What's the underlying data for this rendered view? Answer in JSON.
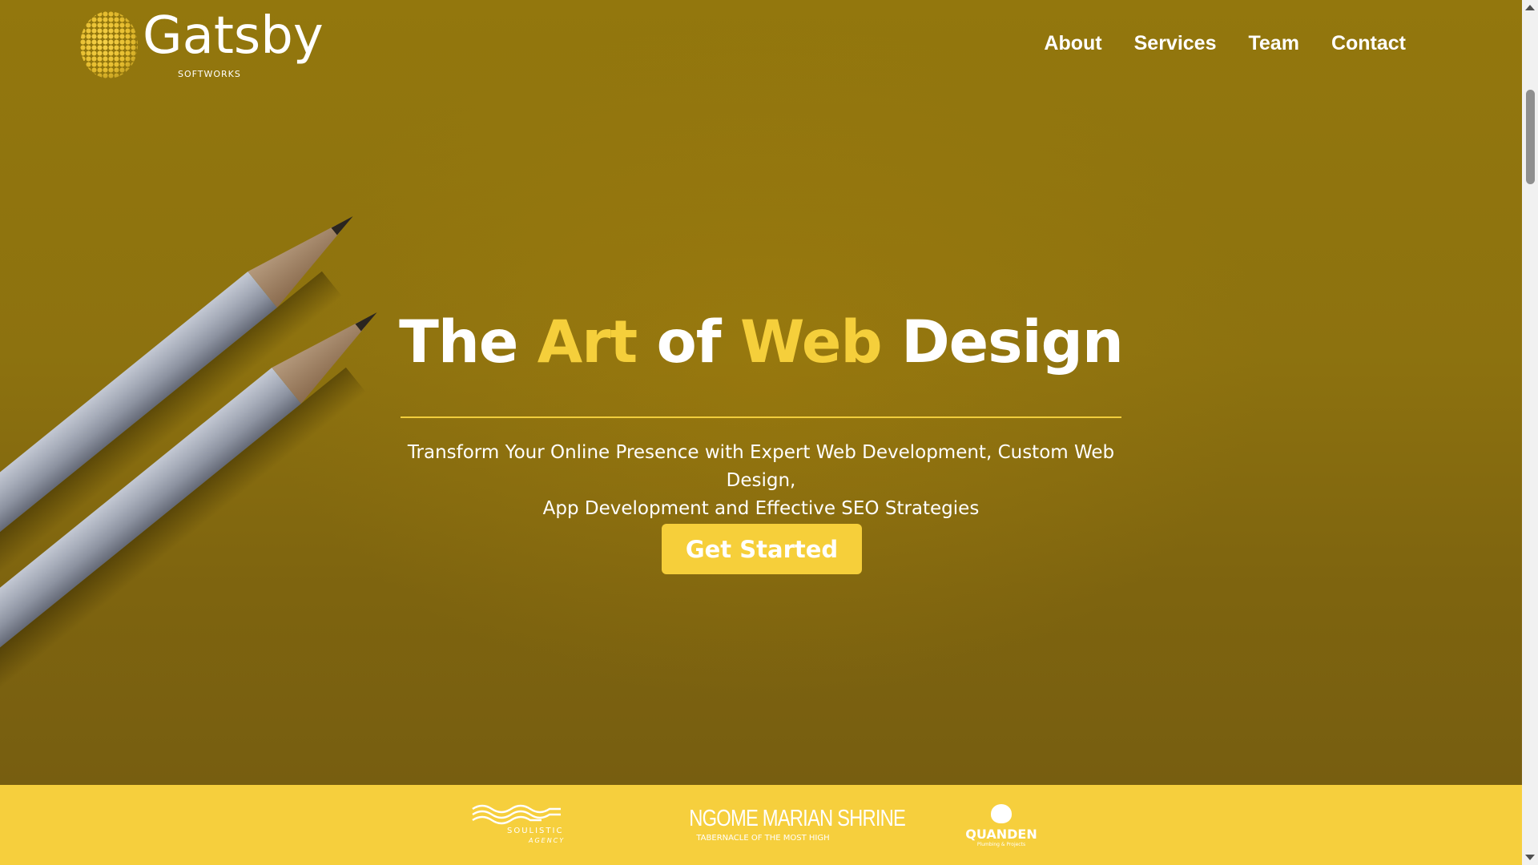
{
  "brand": {
    "name": "Gatsby",
    "tagline": "SOFTWORKS"
  },
  "nav": {
    "items": [
      {
        "label": "About"
      },
      {
        "label": "Services"
      },
      {
        "label": "Team"
      },
      {
        "label": "Contact"
      }
    ]
  },
  "hero": {
    "title_parts": [
      "The",
      "Art",
      "of",
      "Web",
      "Design"
    ],
    "subtitle_line1": "Transform Your Online Presence with Expert Web Development, Custom Web Design,",
    "subtitle_line2": "App Development and Effective SEO Strategies",
    "cta_label": "Get Started"
  },
  "clients": {
    "soulistic": {
      "name": "SOULISTIC",
      "sub": "AGENCY"
    },
    "ngome": {
      "name": "NGOME MARIAN SHRINE",
      "sub": "TABERNACLE OF THE MOST HIGH"
    },
    "quanden": {
      "name": "QUANDEN",
      "sub": "Plumbing & Projects"
    }
  },
  "colors": {
    "background": "#8a6f0e",
    "accent": "#f5cf3b",
    "text": "#ffffff"
  }
}
